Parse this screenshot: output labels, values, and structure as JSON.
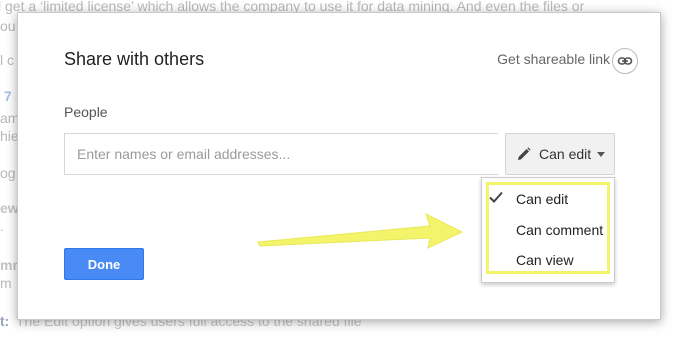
{
  "background": {
    "lines": [
      "l get a ‘limited license’ which allows the company to use it for data mining. And even the files or",
      "ou",
      "l c",
      "7",
      "am",
      "hie",
      "og",
      "ew",
      ".",
      "mm",
      "m",
      "t: The Edit option gives users full access to the shared file"
    ]
  },
  "dialog": {
    "title": "Share with others",
    "shareable_link": "Get shareable link",
    "people_label": "People",
    "input_placeholder": "Enter names or email addresses...",
    "permission_button": "Can edit",
    "done_button": "Done",
    "menu": {
      "items": [
        {
          "label": "Can edit",
          "selected": true
        },
        {
          "label": "Can comment",
          "selected": false
        },
        {
          "label": "Can view",
          "selected": false
        }
      ]
    }
  },
  "colors": {
    "done_blue": "#4a8af4",
    "highlight_yellow": "#f4f46a"
  },
  "icons": {
    "link": "link-icon",
    "pencil": "pencil-icon",
    "caret": "caret-down-icon",
    "check": "check-icon",
    "arrow": "yellow-arrow-annotation"
  }
}
